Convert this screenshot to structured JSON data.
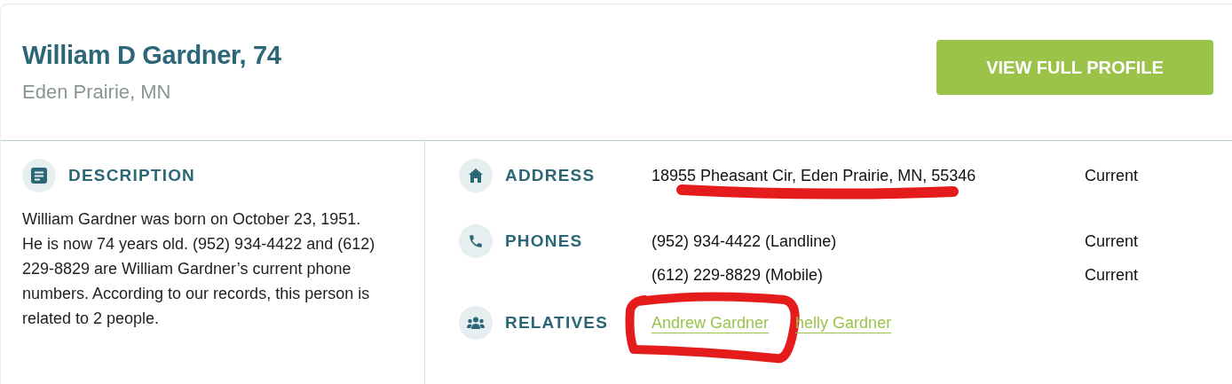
{
  "header": {
    "name": "William D Gardner, 74",
    "location": "Eden Prairie, MN",
    "button": "VIEW FULL PROFILE"
  },
  "description": {
    "heading": "DESCRIPTION",
    "text": "William Gardner was born on October 23, 1951. He is now 74 years old. (952) 934-4422 and (612) 229-8829 are William Gardner’s current phone numbers. According to our records, this person is related to 2 people."
  },
  "sections": [
    {
      "kind": "address",
      "label": "ADDRESS",
      "entries": [
        {
          "value": "18955 Pheasant Cir, Eden Prairie, MN, 55346",
          "status": "Current"
        }
      ]
    },
    {
      "kind": "phones",
      "label": "PHONES",
      "entries": [
        {
          "value": "(952) 934-4422 (Landline)",
          "status": "Current"
        },
        {
          "value": "(612) 229-8829 (Mobile)",
          "status": "Current"
        }
      ]
    },
    {
      "kind": "relatives",
      "label": "RELATIVES",
      "links": [
        "Andrew Gardner",
        "helly Gardner"
      ]
    }
  ]
}
